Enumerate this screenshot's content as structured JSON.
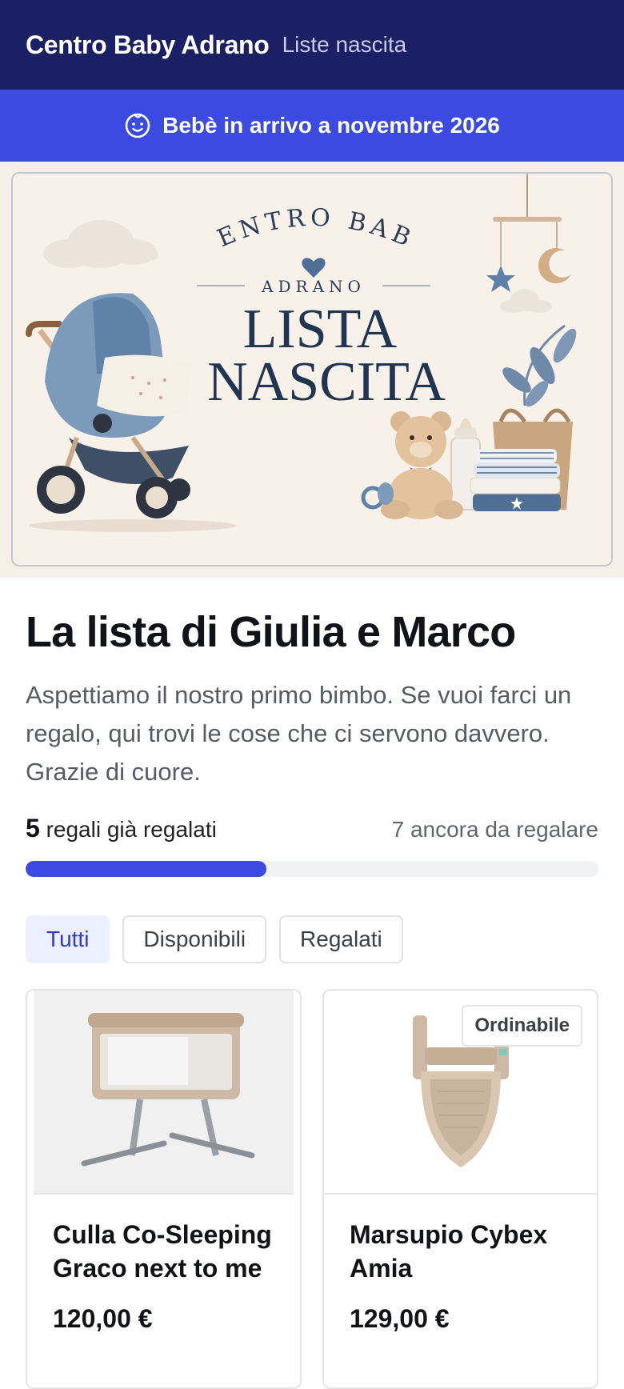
{
  "header": {
    "brand": "Centro Baby Adrano",
    "subtitle": "Liste nascita"
  },
  "announcement": {
    "icon": "baby-face-icon",
    "text": "Bebè in arrivo a novembre 2026"
  },
  "hero": {
    "arc_text": "CENTRO BABY",
    "location": "ADRANO",
    "line1": "LISTA",
    "line2": "NASCITA"
  },
  "list": {
    "title": "La lista di Giulia e Marco",
    "description": "Aspettiamo il nostro primo bimbo. Se vuoi farci un regalo, qui trovi le cose che ci servono davvero. Grazie di cuore.",
    "gifted_count": "5",
    "gifted_label": "regali già regalati",
    "remaining_label": "7 ancora da regalare",
    "progress_fraction": 0.42
  },
  "filters": [
    {
      "label": "Tutti",
      "active": true
    },
    {
      "label": "Disponibili",
      "active": false
    },
    {
      "label": "Regalati",
      "active": false
    }
  ],
  "products": [
    {
      "name": "Culla Co-Sleeping Graco next to me",
      "price": "120,00 €",
      "badge": ""
    },
    {
      "name": "Marsupio Cybex Amia",
      "price": "129,00 €",
      "badge": "Ordinabile"
    }
  ],
  "colors": {
    "header_bg": "#1b2065",
    "accent": "#3b4ae0",
    "hero_bg": "#f8f1e9",
    "hero_text": "#1f3550"
  }
}
